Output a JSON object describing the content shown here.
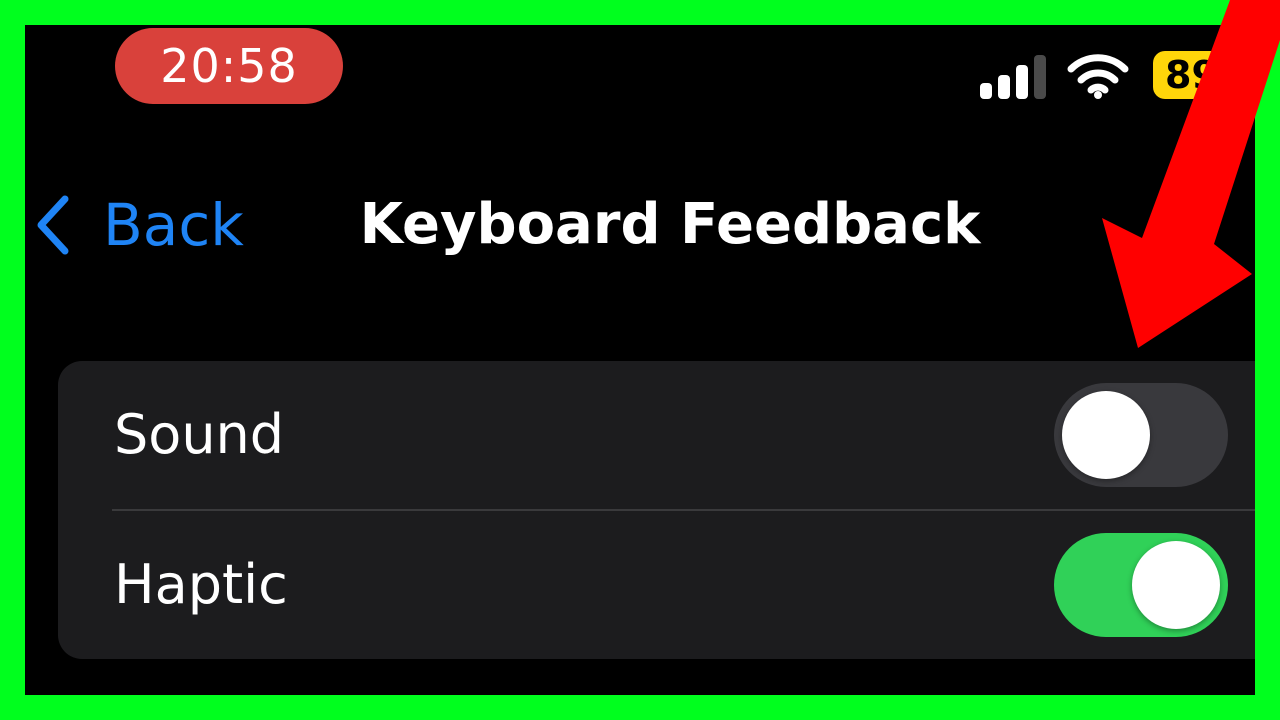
{
  "status_bar": {
    "time": "20:58",
    "battery_level": "89",
    "signal_icon": "cellular-signal-icon",
    "wifi_icon": "wifi-icon"
  },
  "nav": {
    "back_label": "Back",
    "title": "Keyboard Feedback"
  },
  "settings": {
    "rows": [
      {
        "label": "Sound",
        "state": "off"
      },
      {
        "label": "Haptic",
        "state": "on"
      }
    ]
  },
  "colors": {
    "frame": "#00ff1e",
    "accent": "#1f84f5",
    "toggle_on": "#30d158",
    "toggle_off": "#39393d",
    "time_pill": "#d9413b",
    "battery": "#ffd60a",
    "arrow": "#ff0000"
  }
}
